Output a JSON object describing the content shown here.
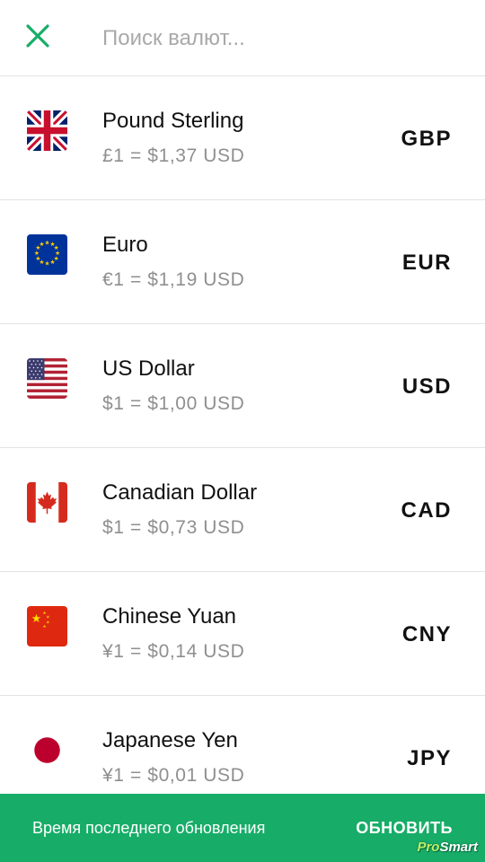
{
  "search": {
    "placeholder": "Поиск валют...",
    "value": ""
  },
  "icons": {
    "close": "close-icon",
    "accent": "#17ad68"
  },
  "currencies": [
    {
      "name": "Pound Sterling",
      "rate": "£1 = $1,37 USD",
      "code": "GBP",
      "flag": "uk-flag-icon"
    },
    {
      "name": "Euro",
      "rate": "€1 = $1,19 USD",
      "code": "EUR",
      "flag": "eu-flag-icon"
    },
    {
      "name": "US Dollar",
      "rate": "$1 = $1,00 USD",
      "code": "USD",
      "flag": "us-flag-icon"
    },
    {
      "name": "Canadian Dollar",
      "rate": "$1 = $0,73 USD",
      "code": "CAD",
      "flag": "canada-flag-icon"
    },
    {
      "name": "Chinese Yuan",
      "rate": "¥1 = $0,14 USD",
      "code": "CNY",
      "flag": "china-flag-icon"
    },
    {
      "name": "Japanese Yen",
      "rate": "¥1 = $0,01 USD",
      "code": "JPY",
      "flag": "japan-flag-icon"
    }
  ],
  "footer": {
    "last_update_label": "Время последнего обновления",
    "refresh_label": "ОБНОВИТЬ",
    "background": "#17ad68"
  },
  "watermark": {
    "brand_prefix": "Pro",
    "brand_suffix": "Smart"
  }
}
